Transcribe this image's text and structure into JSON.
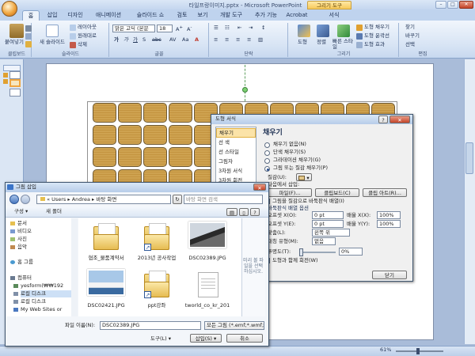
{
  "app": {
    "title": "타일프랑이미지.pptx - Microsoft PowerPoint",
    "context_tab": "그리기 도구"
  },
  "tabs": [
    "홈",
    "삽입",
    "디자인",
    "애니메이션",
    "슬라이드 쇼",
    "검토",
    "보기",
    "개발 도구",
    "추가 기능",
    "Acrobat",
    "서식"
  ],
  "ribbon": {
    "clipboard": {
      "paste": "붙여넣기",
      "group": "클립보드"
    },
    "slides": {
      "new": "새 슬라이드",
      "layout": "레이아웃",
      "reset": "원래대로",
      "delete": "삭제",
      "group": "슬라이드"
    },
    "font": {
      "name": "맑은 고딕 (본문",
      "size": "18",
      "group": "글꼴"
    },
    "paragraph": {
      "group": "단락"
    },
    "drawing": {
      "shapes": "도형",
      "arrange": "정렬",
      "quick": "빠른 스타일",
      "fill": "도형 채우기",
      "outline": "도형 윤곽선",
      "effects": "도형 효과",
      "group": "그리기"
    },
    "editing": {
      "find": "찾기",
      "replace": "바꾸기",
      "select": "선택",
      "group": "편집"
    }
  },
  "shape_dialog": {
    "title": "도형 서식",
    "nav": [
      "채우기",
      "선 색",
      "선 스타일",
      "그림자",
      "3차원 서식",
      "3차원 회전"
    ],
    "heading": "채우기",
    "options": [
      "채우기 없음(N)",
      "단색 채우기(S)",
      "그라데이션 채우기(G)",
      "그림 또는 질감 채우기(P)"
    ],
    "selected_option": 3,
    "texture_label": "질감(U):",
    "insert_from": "다음에서 삽입:",
    "btn_file": "파일(F)...",
    "btn_clipboard": "클립보드(C)",
    "btn_clipart": "클립 아트(R)...",
    "tile_check": "그림을 질감으로 바둑판식 배열(I)",
    "tile_options": "바둑판식 배열 옵션",
    "offset_x_label": "오프셋 X(O):",
    "offset_x": "0 pt",
    "offset_y_label": "오프셋 Y(E):",
    "offset_y": "0 pt",
    "scale_x_label": "배율 X(X):",
    "scale_x": "100%",
    "scale_y_label": "배율 Y(Y):",
    "scale_y": "100%",
    "align_label": "맞춤(L):",
    "align_value": "왼쪽 위",
    "mirror_label": "대칭 유형(M):",
    "mirror_value": "없음",
    "transparency_label": "투명도(T):",
    "transparency_value": "0%",
    "rotate_check": "도형과 함께 회전(W)",
    "close": "닫기"
  },
  "insert_dialog": {
    "title": "그림 삽입",
    "path": [
      "Users",
      "Andrea",
      "바탕 화면"
    ],
    "search_placeholder": "바탕 화면 검색",
    "organize": "구성",
    "new_folder": "새 폴더",
    "nav": [
      "문서",
      "비디오",
      "사진",
      "음악",
      "홈 그룹",
      "컴퓨터",
      "yesform(₩₩192",
      "로컬 디스크",
      "로컬 디스크",
      "My Web Sites or"
    ],
    "preview_text": "미리 볼 파일을 선택하십시오.",
    "files": [
      {
        "name": "협조_물품계약서",
        "type": "folder"
      },
      {
        "name": "2013년 공사작업",
        "type": "folder-shortcut"
      },
      {
        "name": "DSC02389.JPG",
        "type": "photo-dark"
      },
      {
        "name": "DSC02421.JPG",
        "type": "photo-ship"
      },
      {
        "name": "ppt강좌",
        "type": "folder-shortcut"
      },
      {
        "name": "tworld_co_kr_201",
        "type": "doc"
      }
    ],
    "filename_label": "파일 이름(N):",
    "filename_value": "DSC02389.JPG",
    "filter_value": "모든 그림 (*.emf;*.wmf;*.jpg;*.",
    "tools": "도구(L)",
    "insert": "삽입(S)",
    "cancel": "취소"
  },
  "status": {
    "zoom": "61%"
  },
  "colors": {
    "ribbon": "#d6e3f4",
    "tile": "#e3c788",
    "accent": "#f7c95a"
  }
}
